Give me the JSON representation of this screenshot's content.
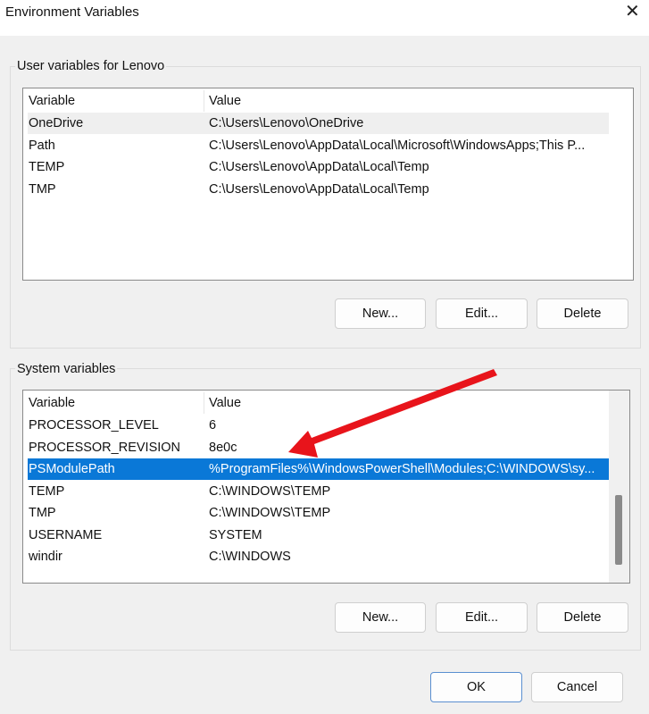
{
  "window": {
    "title": "Environment Variables",
    "close_icon": "close-icon"
  },
  "user": {
    "label": "User variables for Lenovo",
    "headers": [
      "Variable",
      "Value"
    ],
    "rows": [
      [
        "OneDrive",
        "C:\\Users\\Lenovo\\OneDrive"
      ],
      [
        "Path",
        "C:\\Users\\Lenovo\\AppData\\Local\\Microsoft\\WindowsApps;This P..."
      ],
      [
        "TEMP",
        "C:\\Users\\Lenovo\\AppData\\Local\\Temp"
      ],
      [
        "TMP",
        "C:\\Users\\Lenovo\\AppData\\Local\\Temp"
      ]
    ],
    "buttons": {
      "new": "New...",
      "edit": "Edit...",
      "delete": "Delete"
    }
  },
  "system": {
    "label": "System variables",
    "headers": [
      "Variable",
      "Value"
    ],
    "rows": [
      [
        "PROCESSOR_LEVEL",
        "6"
      ],
      [
        "PROCESSOR_REVISION",
        "8e0c"
      ],
      [
        "PSModulePath",
        "%ProgramFiles%\\WindowsPowerShell\\Modules;C:\\WINDOWS\\sy..."
      ],
      [
        "TEMP",
        "C:\\WINDOWS\\TEMP"
      ],
      [
        "TMP",
        "C:\\WINDOWS\\TEMP"
      ],
      [
        "USERNAME",
        "SYSTEM"
      ],
      [
        "windir",
        "C:\\WINDOWS"
      ]
    ],
    "selected_index": 2,
    "buttons": {
      "new": "New...",
      "edit": "Edit...",
      "delete": "Delete"
    }
  },
  "footer": {
    "ok": "OK",
    "cancel": "Cancel"
  },
  "colors": {
    "selection": "#0a78d7",
    "arrow": "#e8141b"
  }
}
